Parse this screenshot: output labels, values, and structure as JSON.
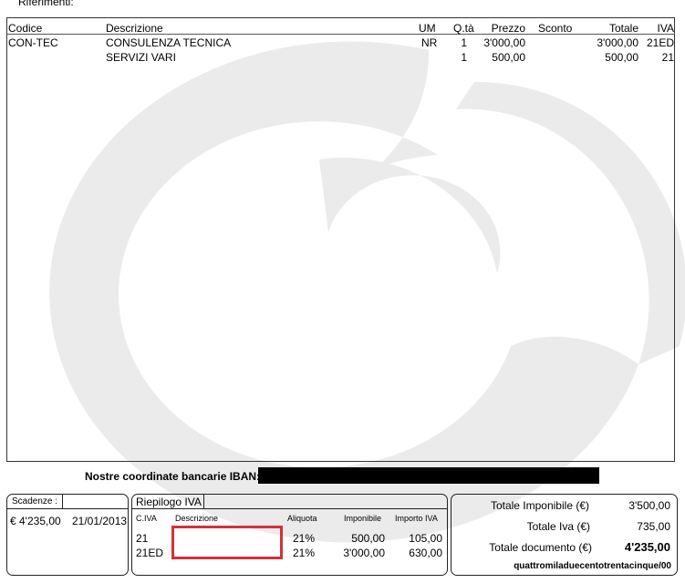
{
  "header": {
    "riferimenti_label": "Riferimenti:"
  },
  "items": {
    "columns": {
      "codice": "Codice",
      "descrizione": "Descrizione",
      "um": "UM",
      "qta": "Q.tà",
      "prezzo": "Prezzo",
      "sconto": "Sconto",
      "totale": "Totale",
      "iva": "IVA"
    },
    "rows": [
      {
        "codice": "CON-TEC",
        "descrizione": "CONSULENZA TECNICA",
        "um": "NR",
        "qta": "1",
        "prezzo": "3'000,00",
        "sconto": "",
        "totale": "3'000,00",
        "iva": "21ED"
      },
      {
        "codice": "",
        "descrizione": "SERVIZI VARI",
        "um": "",
        "qta": "1",
        "prezzo": "500,00",
        "sconto": "",
        "totale": "500,00",
        "iva": "21"
      }
    ]
  },
  "bank": {
    "label": "Nostre coordinate bancarie IBAN:"
  },
  "scadenze": {
    "title": "Scadenze :",
    "rows": [
      {
        "importo": "€ 4'235,00",
        "data": "21/01/2013"
      }
    ]
  },
  "riepilogo": {
    "title": "Riepilogo IVA",
    "columns": {
      "civa": "C.IVA",
      "descrizione": "Descrizione",
      "aliquota": "Aliquota",
      "imponibile": "Imponibile",
      "importo_iva": "Importo IVA"
    },
    "rows": [
      {
        "civa": "21",
        "descrizione": "",
        "aliquota": "21%",
        "imponibile": "500,00",
        "importo_iva": "105,00"
      },
      {
        "civa": "21ED",
        "descrizione": "",
        "aliquota": "21%",
        "imponibile": "3'000,00",
        "importo_iva": "630,00"
      }
    ]
  },
  "totali": {
    "imponibile_label": "Totale Imponibile (€)",
    "imponibile_value": "3'500,00",
    "iva_label": "Totale Iva (€)",
    "iva_value": "735,00",
    "documento_label": "Totale documento (€)",
    "documento_value": "4'235,00",
    "in_lettere": "quattromiladuecentotrentacinque/00"
  },
  "colors": {
    "watermark": "#ebebeb",
    "highlight_box": "#d62f3a"
  }
}
